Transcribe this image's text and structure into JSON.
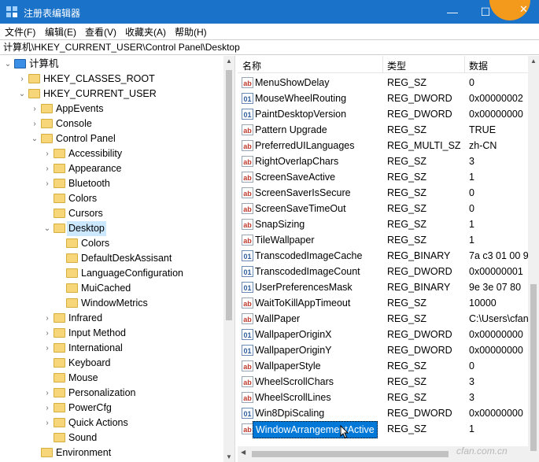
{
  "window": {
    "title": "注册表编辑器"
  },
  "menu": [
    "文件(F)",
    "编辑(E)",
    "查看(V)",
    "收藏夹(A)",
    "帮助(H)"
  ],
  "address": "计算机\\HKEY_CURRENT_USER\\Control Panel\\Desktop",
  "tree": [
    {
      "label": "计算机",
      "indent": 0,
      "chev": "v",
      "icon": "computer"
    },
    {
      "label": "HKEY_CLASSES_ROOT",
      "indent": 1,
      "chev": ">"
    },
    {
      "label": "HKEY_CURRENT_USER",
      "indent": 1,
      "chev": "v"
    },
    {
      "label": "AppEvents",
      "indent": 2,
      "chev": ">"
    },
    {
      "label": "Console",
      "indent": 2,
      "chev": ">"
    },
    {
      "label": "Control Panel",
      "indent": 2,
      "chev": "v"
    },
    {
      "label": "Accessibility",
      "indent": 3,
      "chev": ">"
    },
    {
      "label": "Appearance",
      "indent": 3,
      "chev": ">"
    },
    {
      "label": "Bluetooth",
      "indent": 3,
      "chev": ">"
    },
    {
      "label": "Colors",
      "indent": 3,
      "chev": ""
    },
    {
      "label": "Cursors",
      "indent": 3,
      "chev": ""
    },
    {
      "label": "Desktop",
      "indent": 3,
      "chev": "v",
      "selected": true
    },
    {
      "label": "Colors",
      "indent": 4,
      "chev": ""
    },
    {
      "label": "DefaultDeskAssisant",
      "indent": 4,
      "chev": ""
    },
    {
      "label": "LanguageConfiguration",
      "indent": 4,
      "chev": ""
    },
    {
      "label": "MuiCached",
      "indent": 4,
      "chev": ""
    },
    {
      "label": "WindowMetrics",
      "indent": 4,
      "chev": ""
    },
    {
      "label": "Infrared",
      "indent": 3,
      "chev": ">"
    },
    {
      "label": "Input Method",
      "indent": 3,
      "chev": ">"
    },
    {
      "label": "International",
      "indent": 3,
      "chev": ">"
    },
    {
      "label": "Keyboard",
      "indent": 3,
      "chev": ""
    },
    {
      "label": "Mouse",
      "indent": 3,
      "chev": ""
    },
    {
      "label": "Personalization",
      "indent": 3,
      "chev": ">"
    },
    {
      "label": "PowerCfg",
      "indent": 3,
      "chev": ">"
    },
    {
      "label": "Quick Actions",
      "indent": 3,
      "chev": ">"
    },
    {
      "label": "Sound",
      "indent": 3,
      "chev": ""
    },
    {
      "label": "Environment",
      "indent": 2,
      "chev": ""
    }
  ],
  "columns": {
    "name": "名称",
    "type": "类型",
    "data": "数据"
  },
  "values": [
    {
      "name": "MenuShowDelay",
      "type": "REG_SZ",
      "data": "0",
      "icon": "sz"
    },
    {
      "name": "MouseWheelRouting",
      "type": "REG_DWORD",
      "data": "0x00000002",
      "icon": "bin"
    },
    {
      "name": "PaintDesktopVersion",
      "type": "REG_DWORD",
      "data": "0x00000000",
      "icon": "bin"
    },
    {
      "name": "Pattern Upgrade",
      "type": "REG_SZ",
      "data": "TRUE",
      "icon": "sz"
    },
    {
      "name": "PreferredUILanguages",
      "type": "REG_MULTI_SZ",
      "data": "zh-CN",
      "icon": "sz"
    },
    {
      "name": "RightOverlapChars",
      "type": "REG_SZ",
      "data": "3",
      "icon": "sz"
    },
    {
      "name": "ScreenSaveActive",
      "type": "REG_SZ",
      "data": "1",
      "icon": "sz"
    },
    {
      "name": "ScreenSaverIsSecure",
      "type": "REG_SZ",
      "data": "0",
      "icon": "sz"
    },
    {
      "name": "ScreenSaveTimeOut",
      "type": "REG_SZ",
      "data": "0",
      "icon": "sz"
    },
    {
      "name": "SnapSizing",
      "type": "REG_SZ",
      "data": "1",
      "icon": "sz"
    },
    {
      "name": "TileWallpaper",
      "type": "REG_SZ",
      "data": "1",
      "icon": "sz"
    },
    {
      "name": "TranscodedImageCache",
      "type": "REG_BINARY",
      "data": "7a c3 01 00 9",
      "icon": "bin"
    },
    {
      "name": "TranscodedImageCount",
      "type": "REG_DWORD",
      "data": "0x00000001",
      "icon": "bin"
    },
    {
      "name": "UserPreferencesMask",
      "type": "REG_BINARY",
      "data": "9e 3e 07 80",
      "icon": "bin"
    },
    {
      "name": "WaitToKillAppTimeout",
      "type": "REG_SZ",
      "data": "10000",
      "icon": "sz"
    },
    {
      "name": "WallPaper",
      "type": "REG_SZ",
      "data": "C:\\Users\\cfan",
      "icon": "sz"
    },
    {
      "name": "WallpaperOriginX",
      "type": "REG_DWORD",
      "data": "0x00000000",
      "icon": "bin"
    },
    {
      "name": "WallpaperOriginY",
      "type": "REG_DWORD",
      "data": "0x00000000",
      "icon": "bin"
    },
    {
      "name": "WallpaperStyle",
      "type": "REG_SZ",
      "data": "0",
      "icon": "sz"
    },
    {
      "name": "WheelScrollChars",
      "type": "REG_SZ",
      "data": "3",
      "icon": "sz"
    },
    {
      "name": "WheelScrollLines",
      "type": "REG_SZ",
      "data": "3",
      "icon": "sz"
    },
    {
      "name": "Win8DpiScaling",
      "type": "REG_DWORD",
      "data": "0x00000000",
      "icon": "bin"
    },
    {
      "name": "WindowArrangementActive",
      "type": "REG_SZ",
      "data": "1",
      "icon": "sz",
      "selected": true
    }
  ],
  "watermark": "cfan.com.cn",
  "colors": {
    "titlebar": "#1b73c9",
    "selection": "#0078d7",
    "tree_selection": "#cce8ff"
  }
}
